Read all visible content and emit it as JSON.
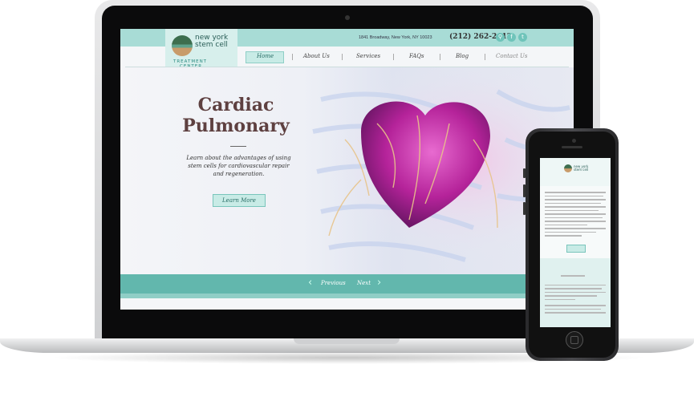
{
  "site": {
    "logo_line1": "new york",
    "logo_line2": "stem cell",
    "logo_sub1": "TREATMENT",
    "logo_sub2": "CENTER",
    "address": "1841 Broadway, New York, NY 10023",
    "phone": "(212) 262-2412",
    "social": [
      {
        "icon": "location-pin-icon",
        "glyph": "⚲"
      },
      {
        "icon": "facebook-icon",
        "glyph": "f"
      },
      {
        "icon": "twitter-icon",
        "glyph": "t"
      }
    ],
    "nav": [
      "Home",
      "About Us",
      "Services",
      "FAQs",
      "Blog",
      "Contact Us"
    ],
    "hero": {
      "title_line1": "Cardiac",
      "title_line2": "Pulmonary",
      "description": "Learn about the advantages of using stem cells for cardiovascular repair and regeneration.",
      "button": "Learn More"
    },
    "pager": {
      "prev": "Previous",
      "next": "Next"
    }
  },
  "colors": {
    "teal": "#62b7ad",
    "light_teal": "#a8dcd6",
    "title_brown": "#5e4040"
  }
}
